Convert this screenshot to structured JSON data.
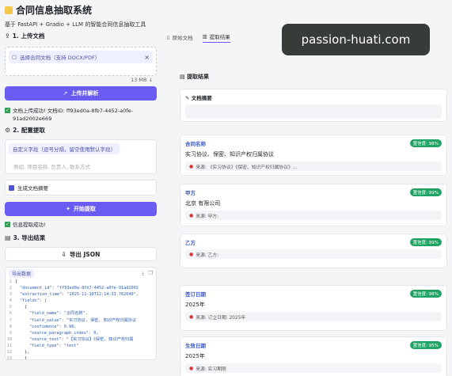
{
  "header": {
    "title": "合同信息抽取系统",
    "subtitle": "基于 FastAPI + Gradio + LLM 的智能合同信息抽取工具"
  },
  "upload": {
    "section_title": "1. 上传文档",
    "chip_label": "选择合同文档（支持 DOCX/PDF）",
    "size": "13 MB ↓",
    "button": "上传并解析",
    "status": "文档上传成功! 文档ID: ff93ed0a-8fb7-4452-a0fe-91ad2002e669"
  },
  "config": {
    "section_title": "2. 配置提取",
    "field_label": "自定义字段（逗号分隔，留空使用默认字段）",
    "field_placeholder": "例如: 项目名称, 负责人, 联系方式",
    "summary_checkbox": "生成文档摘要",
    "button": "开始提取",
    "status": "信息提取成功!"
  },
  "export": {
    "section_title": "3. 导出结果",
    "button": "导出 JSON",
    "data_tag": "导出数据",
    "code": [
      "{",
      "\"document_id\": \"ff93ed0a-8fb7-4452-a0fe-91ad2002",
      "\"extraction_time\": \"2025-11-18T12:14:33.762640\",",
      "\"fields\": [",
      "{",
      "\"field_name\": \"合同名称\",",
      "\"field_value\": \"实习协议, 保密, 知识产权归属协议",
      "\"confidence\": 0.98,",
      "\"source_paragraph_index\": 0,",
      "\"source_text\": \"【实习协议】《保密, 知识产权归属",
      "\"field_type\": \"text\"",
      "},",
      "{",
      "\"field_name\": \"甲方\","
    ]
  },
  "tabs": [
    "原始文档",
    "提取结果"
  ],
  "results": {
    "title": "提取结果",
    "summary_label": "文档摘要",
    "cards": [
      {
        "name": "合同名称",
        "confidence": "置信度: 98%",
        "value": "实习协议、保密、知识产权归属协议",
        "source": "来源: 《实习协议》《保密、知识产权归属协议》..."
      },
      {
        "name": "甲方",
        "confidence": "置信度: 99%",
        "value": "北京            有限公司",
        "source": "来源: 甲方:"
      },
      {
        "name": "乙方",
        "confidence": "置信度: 99%",
        "value": "",
        "source": "来源: 乙方:"
      },
      {
        "name": "签订日期",
        "confidence": "置信度: 98%",
        "value": "2025年",
        "source": "来源: 订立日期: 2025年"
      },
      {
        "name": "生效日期",
        "confidence": "置信度: 95%",
        "value": "2025年",
        "source": "来源: 实习期限"
      }
    ]
  },
  "watermark": "passion-huati.com",
  "colors": {
    "accent": "#6a5cf2",
    "badge": "#1fa463",
    "card_title": "#3b58c4"
  }
}
